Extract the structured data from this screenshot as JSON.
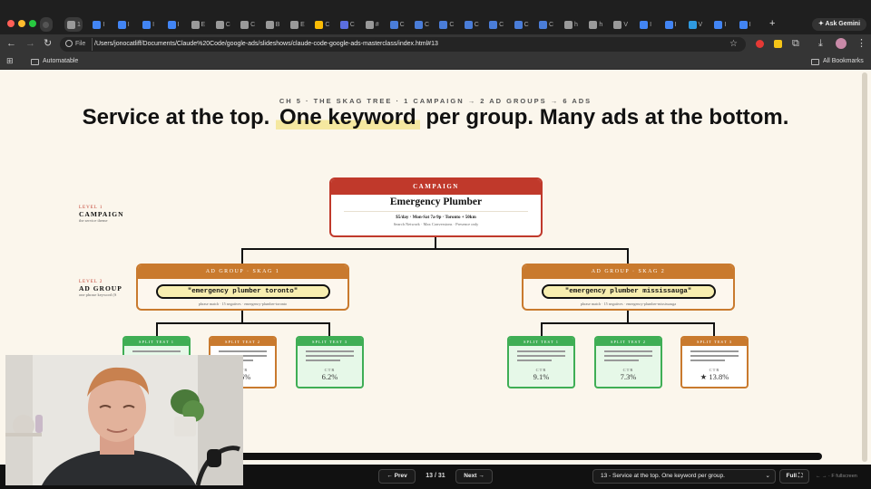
{
  "browser": {
    "tabs": [
      {
        "icon": "chevron-down-icon",
        "label": ""
      },
      {
        "icon": "tab-favicon",
        "label": "1"
      },
      {
        "icon": "google-ads-icon",
        "label": "I"
      },
      {
        "icon": "google-ads-icon",
        "label": "I"
      },
      {
        "icon": "google-ads-icon",
        "label": "I"
      },
      {
        "icon": "google-ads-icon",
        "label": "I"
      },
      {
        "icon": "tab-favicon",
        "label": "E"
      },
      {
        "icon": "tab-favicon",
        "label": "C"
      },
      {
        "icon": "tab-favicon",
        "label": "C"
      },
      {
        "icon": "tab-favicon",
        "label": "B"
      },
      {
        "icon": "tab-favicon",
        "label": "E"
      },
      {
        "icon": "google-icon",
        "label": "C"
      },
      {
        "icon": "shield-icon",
        "label": "C"
      },
      {
        "icon": "tab-favicon",
        "label": "#"
      },
      {
        "icon": "doc-icon",
        "label": "C"
      },
      {
        "icon": "doc-icon",
        "label": "C"
      },
      {
        "icon": "doc-icon",
        "label": "C"
      },
      {
        "icon": "doc-icon",
        "label": "C"
      },
      {
        "icon": "doc-icon",
        "label": "C"
      },
      {
        "icon": "doc-icon",
        "label": "C"
      },
      {
        "icon": "doc-icon",
        "label": "C"
      },
      {
        "icon": "tab-favicon",
        "label": "h"
      },
      {
        "icon": "tab-favicon",
        "label": "h"
      },
      {
        "icon": "tab-favicon",
        "label": "V"
      },
      {
        "icon": "google-ads-icon",
        "label": "I"
      },
      {
        "icon": "google-ads-icon",
        "label": "I"
      },
      {
        "icon": "vscode-icon",
        "label": "V"
      },
      {
        "icon": "google-ads-icon",
        "label": "I"
      },
      {
        "icon": "google-ads-icon",
        "label": "I"
      }
    ],
    "new_tab_label": "+",
    "ask_gemini": "Ask Gemini",
    "url_scheme": "File",
    "url": "/Users/jonocatliff/Documents/Claude%20Code/google-ads/slideshows/claude-code-google-ads-masterclass/index.html#13",
    "bookmark_folder": "Automatable",
    "all_bookmarks": "All Bookmarks"
  },
  "slide": {
    "kicker": "CH 5 · THE SKAG TREE · 1 CAMPAIGN → 2 AD GROUPS → 6 ADS",
    "title_before": "Service at the top.",
    "title_highlight": "One keyword",
    "title_after": "per group. Many ads at the bottom.",
    "levels": [
      {
        "tag": "LEVEL 1",
        "name": "CAMPAIGN",
        "desc": "the service theme"
      },
      {
        "tag": "LEVEL 2",
        "name": "AD GROUP",
        "desc": "one phrase keyword (S"
      }
    ],
    "campaign": {
      "header": "CAMPAIGN",
      "title": "Emergency Plumber",
      "line1": "$5/day · Mon-Sat 7a-9p · Toronto + 50km",
      "line2": "Search Network · Max Conversions · Presence only"
    },
    "ad_groups": [
      {
        "header": "AD GROUP · SKAG 1",
        "keyword": "\"emergency plumber toronto\"",
        "sub": "phrase match · 15 negatives · emergency-plumber-toronto"
      },
      {
        "header": "AD GROUP · SKAG 2",
        "keyword": "\"emergency plumber mississauga\"",
        "sub": "phrase match · 15 negatives · emergency-plumber-mississauga"
      }
    ],
    "split_tests": [
      {
        "header": "SPLIT TEST 1",
        "ctr_label": "CTR",
        "ctr": "",
        "variant": "green"
      },
      {
        "header": "SPLIT TEST 2",
        "ctr_label": "CTR",
        "ctr": "2.6%",
        "variant": "orange"
      },
      {
        "header": "SPLIT TEST 3",
        "ctr_label": "CTR",
        "ctr": "6.2%",
        "variant": "green"
      },
      {
        "header": "SPLIT TEST 1",
        "ctr_label": "CTR",
        "ctr": "9.1%",
        "variant": "green"
      },
      {
        "header": "SPLIT TEST 2",
        "ctr_label": "CTR",
        "ctr": "7.3%",
        "variant": "green"
      },
      {
        "header": "SPLIT TEST 3",
        "ctr_label": "CTR",
        "ctr": "★ 13.8%",
        "variant": "orange"
      }
    ]
  },
  "nav": {
    "prev": "← Prev",
    "counter": "13 / 31",
    "next": "Next →",
    "slide_select": "13 - Service at the top. One keyword per group.",
    "full": "Full",
    "hint": "← → · F fullscreen"
  },
  "colors": {
    "campaign": "#c0392b",
    "ad_group": "#c97a2e",
    "split_green": "#3fae55",
    "page_bg": "#fbf6ec"
  }
}
